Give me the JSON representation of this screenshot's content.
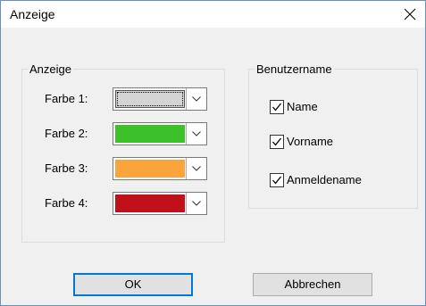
{
  "window": {
    "title": "Anzeige",
    "close_icon": "close-icon"
  },
  "display_group": {
    "legend": "Anzeige",
    "rows": [
      {
        "label": "Farbe 1:",
        "color": "#d4d4d4",
        "selected": true
      },
      {
        "label": "Farbe 2:",
        "color": "#3dc12a",
        "selected": false
      },
      {
        "label": "Farbe 3:",
        "color": "#f9a53b",
        "selected": false
      },
      {
        "label": "Farbe 4:",
        "color": "#c0101a",
        "selected": false
      }
    ]
  },
  "user_group": {
    "legend": "Benutzername",
    "options": [
      {
        "label": "Name",
        "checked": true
      },
      {
        "label": "Vorname",
        "checked": true
      },
      {
        "label": "Anmeldename",
        "checked": true
      }
    ]
  },
  "buttons": {
    "ok": "OK",
    "cancel": "Abbrechen"
  }
}
